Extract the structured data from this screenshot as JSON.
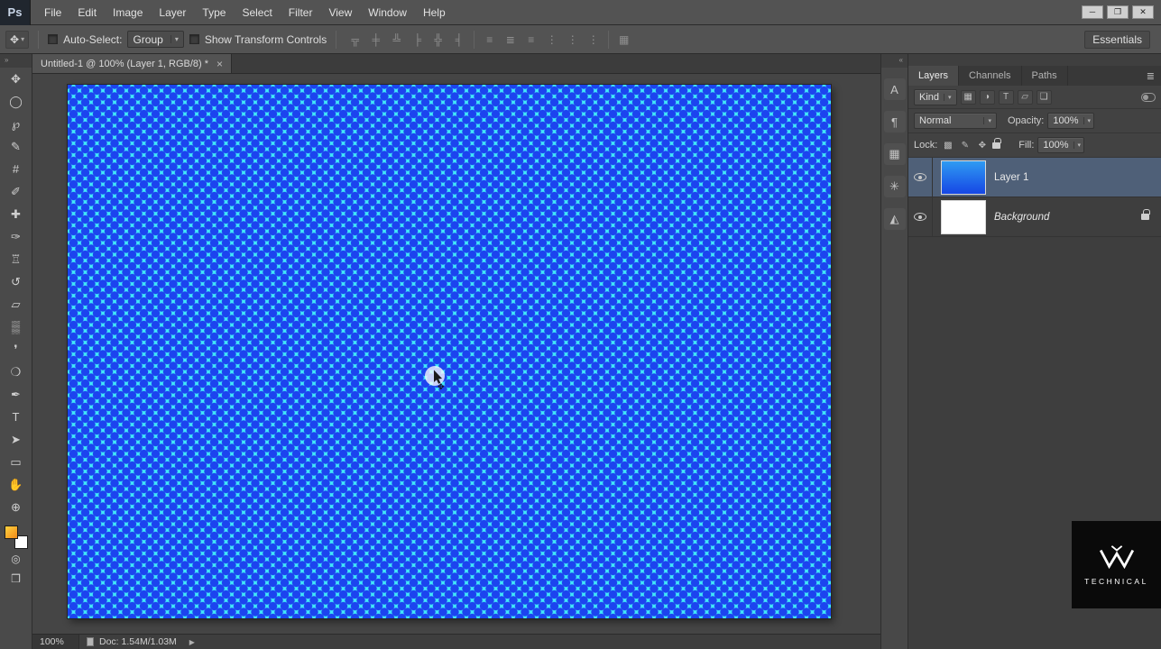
{
  "colors": {
    "canvas_dot": "#1c44ef",
    "canvas_background": "#41e7f8",
    "selected_layer_row": "#4f6078",
    "foreground_swatch": "#f5a623",
    "ui_background": "#535353",
    "watermark_background": "#0a0a0a"
  },
  "ui": {
    "dropdown_arrow": "▾"
  },
  "window_controls": {
    "minimize": "─",
    "restore": "❐",
    "close": "✕"
  },
  "menu": {
    "logo": "Ps",
    "items": [
      "File",
      "Edit",
      "Image",
      "Layer",
      "Type",
      "Select",
      "Filter",
      "View",
      "Window",
      "Help"
    ]
  },
  "options": {
    "tool_icon": "✥",
    "auto_select": {
      "label": "Auto-Select:",
      "value": "Group"
    },
    "show_transform": {
      "label": "Show Transform Controls"
    },
    "align": [
      {
        "glyph": "╦"
      },
      {
        "glyph": "╪"
      },
      {
        "glyph": "╩"
      },
      {
        "glyph": "╞"
      },
      {
        "glyph": "╬"
      },
      {
        "glyph": "╡"
      },
      {
        "glyph": "≡"
      },
      {
        "glyph": "≣"
      },
      {
        "glyph": "≡"
      },
      {
        "glyph": "⋮"
      },
      {
        "glyph": "⋮"
      },
      {
        "glyph": "⋮"
      },
      {
        "glyph": "▦"
      }
    ],
    "workspace": "Essentials"
  },
  "document_tab": {
    "title": "Untitled-1 @ 100% (Layer 1, RGB/8) *",
    "close": "×"
  },
  "toolbar": {
    "grip": "»",
    "tools": [
      {
        "glyph": "✥"
      },
      {
        "glyph": "◯"
      },
      {
        "glyph": "℘"
      },
      {
        "glyph": "✎"
      },
      {
        "glyph": "#"
      },
      {
        "glyph": "✐"
      },
      {
        "glyph": "✚"
      },
      {
        "glyph": "✑"
      },
      {
        "glyph": "♖"
      },
      {
        "glyph": "↺"
      },
      {
        "glyph": "▱"
      },
      {
        "glyph": "▒"
      },
      {
        "glyph": "❜"
      },
      {
        "glyph": "❍"
      },
      {
        "glyph": "✒"
      },
      {
        "glyph": "T"
      },
      {
        "glyph": "➤"
      },
      {
        "glyph": "▭"
      },
      {
        "glyph": "✋"
      },
      {
        "glyph": "⊕"
      }
    ],
    "extra_icons": [
      {
        "glyph": "◎"
      },
      {
        "glyph": "❒"
      }
    ]
  },
  "panel_strip": {
    "grip": "«",
    "icons": [
      {
        "glyph": "A"
      },
      {
        "glyph": "¶"
      },
      {
        "glyph": "▦"
      },
      {
        "glyph": "✳"
      },
      {
        "glyph": "◭"
      }
    ]
  },
  "layers_panel": {
    "tabs": [
      "Layers",
      "Channels",
      "Paths"
    ],
    "panel_menu": "≣",
    "kind": {
      "label": "Kind"
    },
    "filter_icons": [
      {
        "glyph": "▦"
      },
      {
        "glyph": "◑"
      },
      {
        "glyph": "T"
      },
      {
        "glyph": "▱"
      },
      {
        "glyph": "❏"
      }
    ],
    "blend_mode": "Normal",
    "opacity": {
      "label": "Opacity:",
      "value": "100%"
    },
    "lock": {
      "label": "Lock:",
      "icons": [
        {
          "glyph": "▩"
        },
        {
          "glyph": "✎"
        },
        {
          "glyph": "✥"
        }
      ]
    },
    "fill": {
      "label": "Fill:",
      "value": "100%"
    },
    "rows": [
      {
        "name": "Layer 1",
        "selected": true
      },
      {
        "name": "Background",
        "locked": true
      }
    ]
  },
  "status_bar": {
    "zoom": "100%",
    "doc": "Doc: 1.54M/1.03M",
    "expand_arrow": "▶"
  },
  "watermark": {
    "text": "TECHNICAL"
  }
}
